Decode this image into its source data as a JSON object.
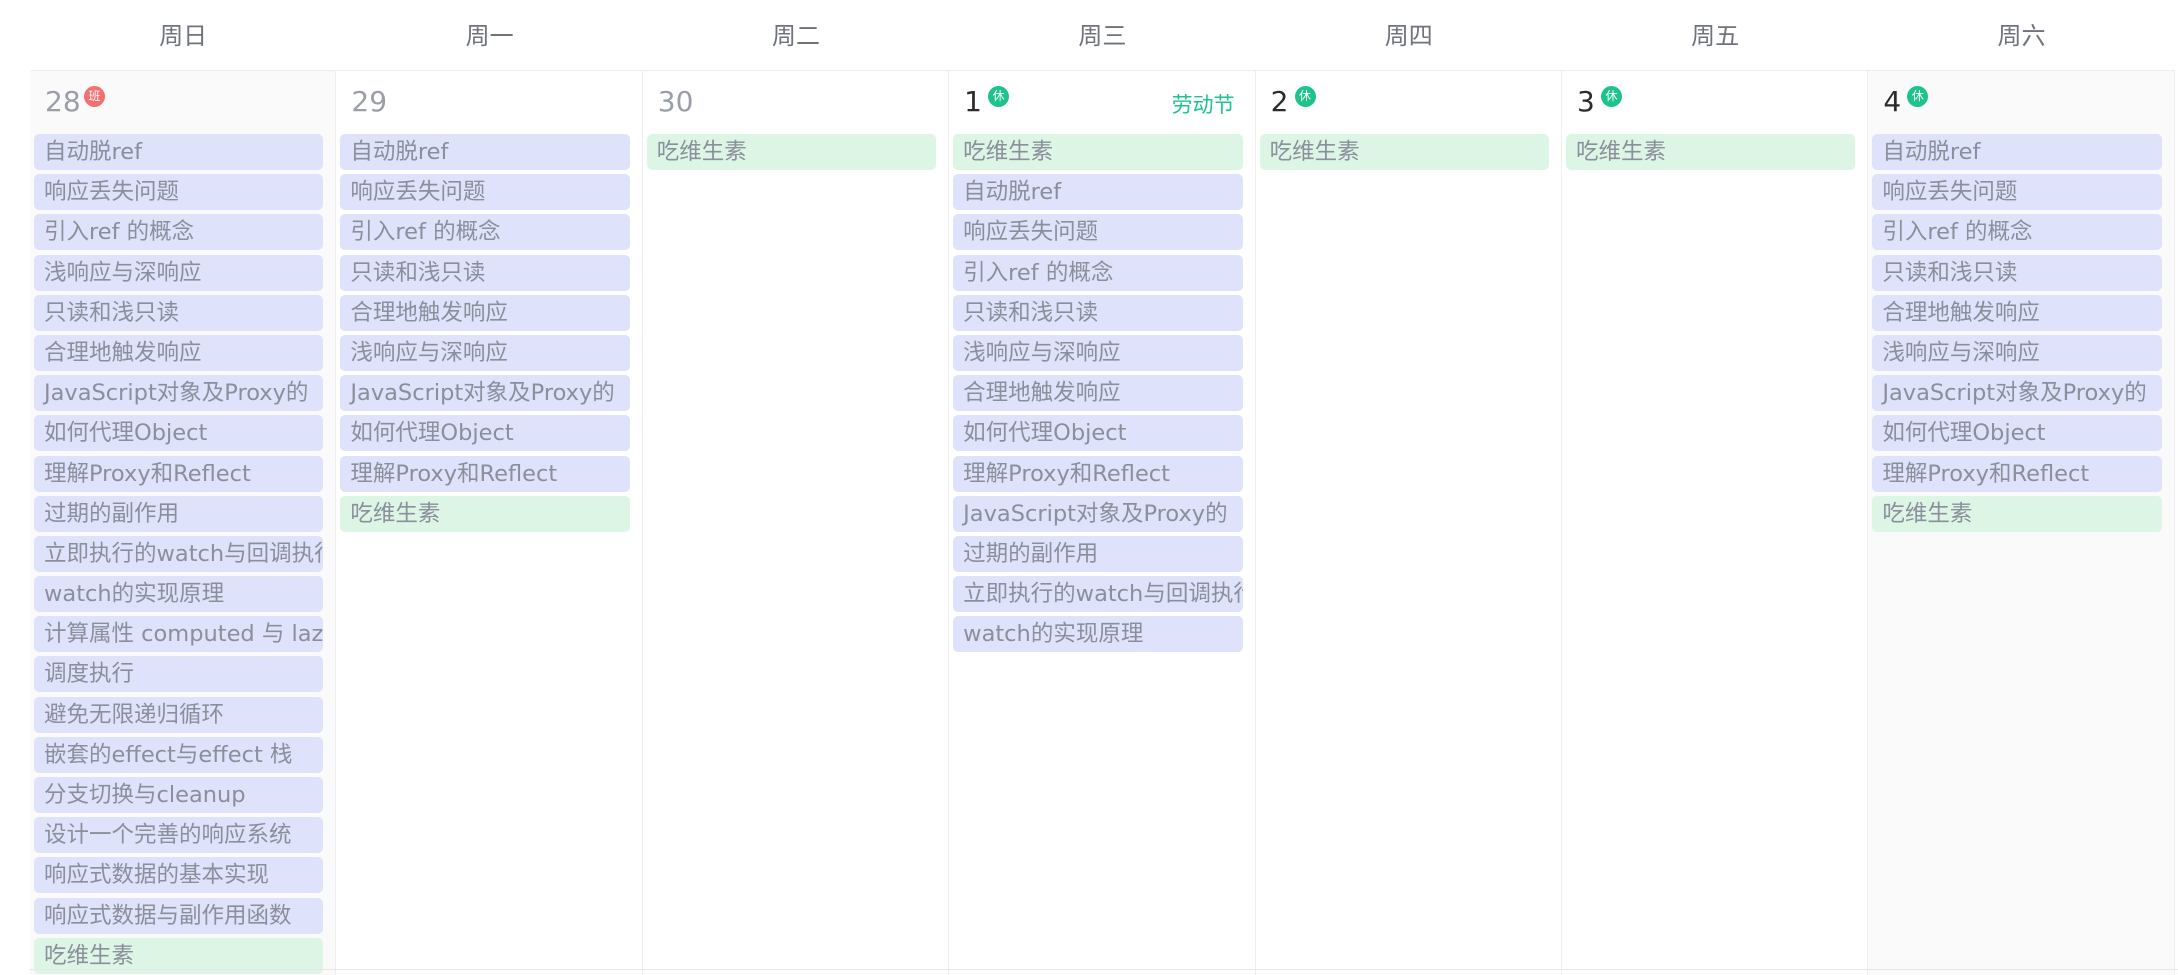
{
  "weekdays": [
    "周日",
    "周一",
    "周二",
    "周三",
    "周四",
    "周五",
    "周六"
  ],
  "days": [
    {
      "date": "28",
      "badge": "班",
      "badge_type": "work",
      "holiday": "",
      "current_month": false,
      "events": [
        {
          "title": "自动脱ref",
          "color": "blue"
        },
        {
          "title": "响应丢失问题",
          "color": "blue"
        },
        {
          "title": "引入ref 的概念",
          "color": "blue"
        },
        {
          "title": "浅响应与深响应",
          "color": "blue"
        },
        {
          "title": "只读和浅只读",
          "color": "blue"
        },
        {
          "title": "合理地触发响应",
          "color": "blue"
        },
        {
          "title": "JavaScript对象及Proxy的",
          "color": "blue"
        },
        {
          "title": "如何代理Object",
          "color": "blue"
        },
        {
          "title": "理解Proxy和Reflect",
          "color": "blue"
        },
        {
          "title": "过期的副作用",
          "color": "blue"
        },
        {
          "title": "立即执行的watch与回调执行时机",
          "color": "blue"
        },
        {
          "title": "watch的实现原理",
          "color": "blue"
        },
        {
          "title": "计算属性 computed 与 lazy",
          "color": "blue"
        },
        {
          "title": "调度执行",
          "color": "blue"
        },
        {
          "title": "避免无限递归循环",
          "color": "blue"
        },
        {
          "title": "嵌套的effect与effect 栈",
          "color": "blue"
        },
        {
          "title": "分支切换与cleanup",
          "color": "blue"
        },
        {
          "title": "设计一个完善的响应系统",
          "color": "blue"
        },
        {
          "title": "响应式数据的基本实现",
          "color": "blue"
        },
        {
          "title": "响应式数据与副作用函数",
          "color": "blue"
        },
        {
          "title": "吃维生素",
          "color": "green"
        }
      ]
    },
    {
      "date": "29",
      "badge": "",
      "badge_type": "",
      "holiday": "",
      "current_month": false,
      "events": [
        {
          "title": "自动脱ref",
          "color": "blue"
        },
        {
          "title": "响应丢失问题",
          "color": "blue"
        },
        {
          "title": "引入ref 的概念",
          "color": "blue"
        },
        {
          "title": "只读和浅只读",
          "color": "blue"
        },
        {
          "title": "合理地触发响应",
          "color": "blue"
        },
        {
          "title": "浅响应与深响应",
          "color": "blue"
        },
        {
          "title": "JavaScript对象及Proxy的",
          "color": "blue"
        },
        {
          "title": "如何代理Object",
          "color": "blue"
        },
        {
          "title": "理解Proxy和Reflect",
          "color": "blue"
        },
        {
          "title": "吃维生素",
          "color": "green"
        }
      ]
    },
    {
      "date": "30",
      "badge": "",
      "badge_type": "",
      "holiday": "",
      "current_month": false,
      "events": [
        {
          "title": "吃维生素",
          "color": "green"
        }
      ]
    },
    {
      "date": "1",
      "badge": "休",
      "badge_type": "rest",
      "holiday": "劳动节",
      "current_month": true,
      "events": [
        {
          "title": "吃维生素",
          "color": "green"
        },
        {
          "title": "自动脱ref",
          "color": "blue"
        },
        {
          "title": "响应丢失问题",
          "color": "blue"
        },
        {
          "title": "引入ref 的概念",
          "color": "blue"
        },
        {
          "title": "只读和浅只读",
          "color": "blue"
        },
        {
          "title": "浅响应与深响应",
          "color": "blue"
        },
        {
          "title": "合理地触发响应",
          "color": "blue"
        },
        {
          "title": "如何代理Object",
          "color": "blue"
        },
        {
          "title": "理解Proxy和Reflect",
          "color": "blue"
        },
        {
          "title": "JavaScript对象及Proxy的",
          "color": "blue"
        },
        {
          "title": "过期的副作用",
          "color": "blue"
        },
        {
          "title": "立即执行的watch与回调执行时机",
          "color": "blue"
        },
        {
          "title": "watch的实现原理",
          "color": "blue"
        }
      ]
    },
    {
      "date": "2",
      "badge": "休",
      "badge_type": "rest",
      "holiday": "",
      "current_month": true,
      "events": [
        {
          "title": "吃维生素",
          "color": "green"
        }
      ]
    },
    {
      "date": "3",
      "badge": "休",
      "badge_type": "rest",
      "holiday": "",
      "current_month": true,
      "events": [
        {
          "title": "吃维生素",
          "color": "green"
        }
      ]
    },
    {
      "date": "4",
      "badge": "休",
      "badge_type": "rest",
      "holiday": "",
      "current_month": true,
      "events": [
        {
          "title": "自动脱ref",
          "color": "blue"
        },
        {
          "title": "响应丢失问题",
          "color": "blue"
        },
        {
          "title": "引入ref 的概念",
          "color": "blue"
        },
        {
          "title": "只读和浅只读",
          "color": "blue"
        },
        {
          "title": "合理地触发响应",
          "color": "blue"
        },
        {
          "title": "浅响应与深响应",
          "color": "blue"
        },
        {
          "title": "JavaScript对象及Proxy的",
          "color": "blue"
        },
        {
          "title": "如何代理Object",
          "color": "blue"
        },
        {
          "title": "理解Proxy和Reflect",
          "color": "blue"
        },
        {
          "title": "吃维生素",
          "color": "green"
        }
      ]
    }
  ],
  "colors": {
    "event_blue": "#dee3fb",
    "event_green": "#dcf5e5",
    "rest_badge": "#1cc48a",
    "work_badge": "#f46f6f",
    "holiday_text": "#1cc48a"
  }
}
